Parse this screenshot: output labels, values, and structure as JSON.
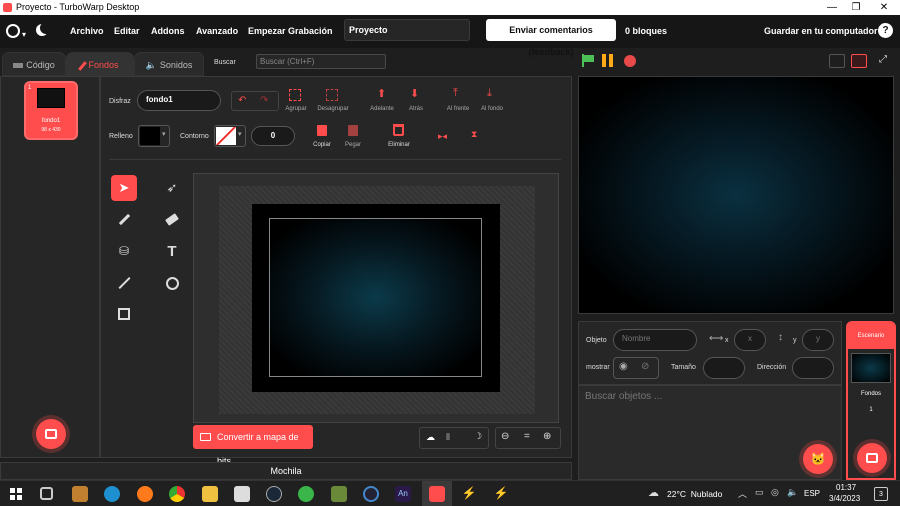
{
  "window": {
    "title": "Proyecto - TurboWarp Desktop",
    "controls": [
      "—",
      "❐",
      "✕"
    ]
  },
  "menu": {
    "items": [
      "Archivo",
      "Editar",
      "Addons",
      "Avanzado",
      "Empezar Grabación"
    ],
    "project_name": "Proyecto",
    "feedback": "Enviar comentarios (feedback)",
    "blocks": "0 bloques",
    "save": "Guardar en tu computador",
    "help": "?"
  },
  "tabs": {
    "code": "Código",
    "costumes": "Fondos",
    "sounds": "Sonidos"
  },
  "search": {
    "label": "Buscar",
    "placeholder": "Buscar (Ctrl+F)"
  },
  "costume_list": [
    {
      "index": "1",
      "name": "fondo1",
      "size": "98 x 430"
    }
  ],
  "editor": {
    "costume_label": "Disfraz",
    "costume_name": "fondo1",
    "group": "Agrupar",
    "ungroup": "Desagrupar",
    "forward": "Adelante",
    "backward": "Atrás",
    "front": "Al frente",
    "back": "Al fondo",
    "fill": "Relleno",
    "outline": "Contorno",
    "outline_size": "0",
    "copy": "Copiar",
    "paste": "Pegar",
    "delete": "Eliminar",
    "convert": "Convertir a mapa de bits"
  },
  "sprite_info": {
    "object": "Objeto",
    "name_placeholder": "Nombre",
    "x_label": "x",
    "x_placeholder": "x",
    "y_label": "y",
    "y_placeholder": "y",
    "show": "mostrar",
    "size": "Tamaño",
    "direction": "Dirección",
    "search_placeholder": "Buscar objetos ..."
  },
  "stage_panel": {
    "title": "Escenario",
    "backdrops_label": "Fondos",
    "backdrops_count": "1"
  },
  "backpack": "Mochila",
  "taskbar": {
    "weather": "22°C  Nublado",
    "lang": "ESP",
    "time": "01:37",
    "date": "3/4/2023",
    "notif": "3"
  },
  "colors": {
    "accent": "#ff4c4c",
    "green_flag": "#4cbf56",
    "pause": "#ffab19"
  }
}
